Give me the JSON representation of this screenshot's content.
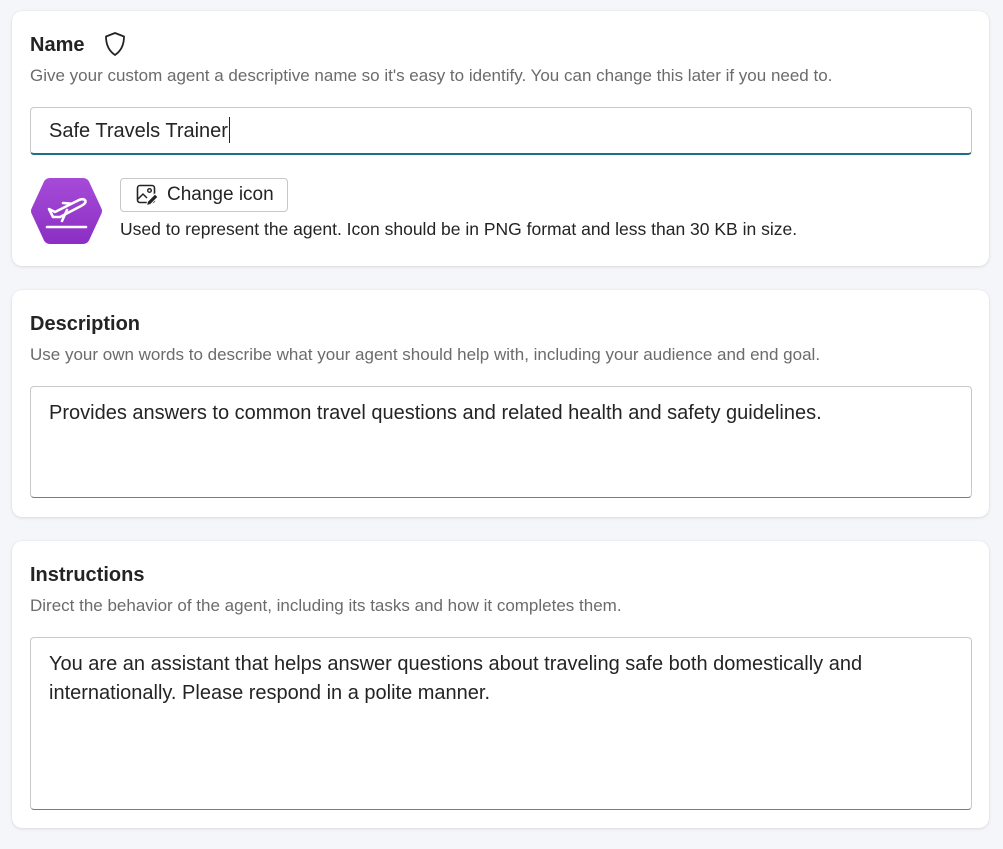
{
  "name_section": {
    "title": "Name",
    "help": "Give your custom agent a descriptive name so it's easy to identify. You can change this later if you need to.",
    "input_value": "Safe Travels Trainer",
    "change_icon_label": "Change icon",
    "icon_hint": "Used to represent the agent. Icon should be in PNG format and less than 30 KB in size.",
    "agent_icon": "airplane-takeoff-icon",
    "agent_icon_color": "#9b3fcf"
  },
  "description_section": {
    "title": "Description",
    "help": "Use your own words to describe what your agent should help with, including your audience and end goal.",
    "value": "Provides answers to common travel questions and related health and safety guidelines."
  },
  "instructions_section": {
    "title": "Instructions",
    "help": "Direct the behavior of the agent, including its tasks and how it completes them.",
    "value": "You are an assistant that helps answer questions about traveling safe both domestically and internationally. Please respond in a polite manner."
  },
  "colors": {
    "focus_underline": "#1f6f8b",
    "background": "#f5f6fa"
  }
}
